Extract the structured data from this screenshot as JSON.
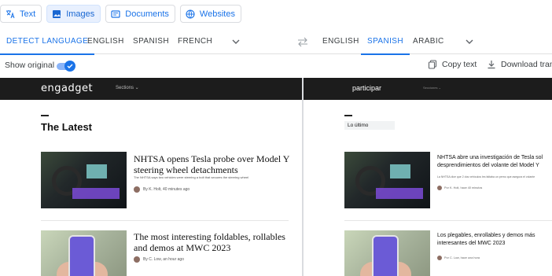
{
  "modes": [
    {
      "label": "Text",
      "icon": "translate-icon",
      "active": false
    },
    {
      "label": "Images",
      "icon": "image-icon",
      "active": true
    },
    {
      "label": "Documents",
      "icon": "document-icon",
      "active": false
    },
    {
      "label": "Websites",
      "icon": "globe-icon",
      "active": false
    }
  ],
  "source_langs": [
    "DETECT LANGUAGE",
    "ENGLISH",
    "SPANISH",
    "FRENCH"
  ],
  "target_langs": [
    "ENGLISH",
    "SPANISH",
    "ARABIC"
  ],
  "toolbar": {
    "show_original": "Show original",
    "show_original_on": true,
    "copy_text": "Copy text",
    "download": "Download trans"
  },
  "original": {
    "logo": "engadget",
    "nav": "Sections",
    "heading": "The Latest",
    "articles": [
      {
        "title": "NHTSA opens Tesla probe over Model Y steering wheel detachments",
        "sub": "The NHTSA says two vehicles were steering a bolt that secures the steering wheel",
        "byline": "By K. Holt, 40 minutes ago"
      },
      {
        "title": "The most interesting foldables, rollables and demos at MWC 2023",
        "byline": "By C. Low, an hour ago"
      }
    ]
  },
  "translated": {
    "nav": "participar",
    "nav_small": "Secciones",
    "heading": "Lo último",
    "articles": [
      {
        "title_line1": "NHTSA abre una investigación de Tesla sol",
        "title_line2": "desprendimientos del volante del Model Y",
        "sub": "La NHTSA dice que 2 dos vehículos les faltaba un perno que asegura el volante",
        "byline": "Por K. Holt, hace 40 minutos"
      },
      {
        "title_line1": "Los plegables, enrollables y demos más",
        "title_line2": "interesantes del MWC 2023",
        "byline": "Por C. Low, hace una hora"
      }
    ]
  },
  "colors": {
    "accent": "#1a73e8",
    "active_chip_bg": "#e8f0fe",
    "header_bar": "#1c1c1c"
  }
}
